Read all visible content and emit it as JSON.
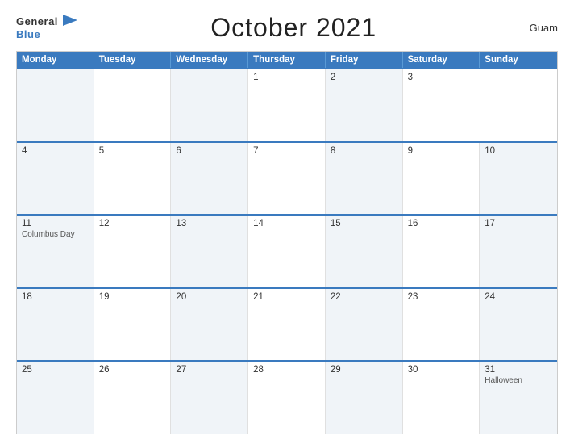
{
  "header": {
    "logo_general": "General",
    "logo_blue": "Blue",
    "title": "October 2021",
    "region": "Guam"
  },
  "calendar": {
    "days": [
      "Monday",
      "Tuesday",
      "Wednesday",
      "Thursday",
      "Friday",
      "Saturday",
      "Sunday"
    ],
    "weeks": [
      [
        {
          "date": "",
          "event": ""
        },
        {
          "date": "",
          "event": ""
        },
        {
          "date": "",
          "event": ""
        },
        {
          "date": "1",
          "event": ""
        },
        {
          "date": "2",
          "event": ""
        },
        {
          "date": "3",
          "event": ""
        }
      ],
      [
        {
          "date": "4",
          "event": ""
        },
        {
          "date": "5",
          "event": ""
        },
        {
          "date": "6",
          "event": ""
        },
        {
          "date": "7",
          "event": ""
        },
        {
          "date": "8",
          "event": ""
        },
        {
          "date": "9",
          "event": ""
        },
        {
          "date": "10",
          "event": ""
        }
      ],
      [
        {
          "date": "11",
          "event": "Columbus Day"
        },
        {
          "date": "12",
          "event": ""
        },
        {
          "date": "13",
          "event": ""
        },
        {
          "date": "14",
          "event": ""
        },
        {
          "date": "15",
          "event": ""
        },
        {
          "date": "16",
          "event": ""
        },
        {
          "date": "17",
          "event": ""
        }
      ],
      [
        {
          "date": "18",
          "event": ""
        },
        {
          "date": "19",
          "event": ""
        },
        {
          "date": "20",
          "event": ""
        },
        {
          "date": "21",
          "event": ""
        },
        {
          "date": "22",
          "event": ""
        },
        {
          "date": "23",
          "event": ""
        },
        {
          "date": "24",
          "event": ""
        }
      ],
      [
        {
          "date": "25",
          "event": ""
        },
        {
          "date": "26",
          "event": ""
        },
        {
          "date": "27",
          "event": ""
        },
        {
          "date": "28",
          "event": ""
        },
        {
          "date": "29",
          "event": ""
        },
        {
          "date": "30",
          "event": ""
        },
        {
          "date": "31",
          "event": "Halloween"
        }
      ]
    ]
  }
}
